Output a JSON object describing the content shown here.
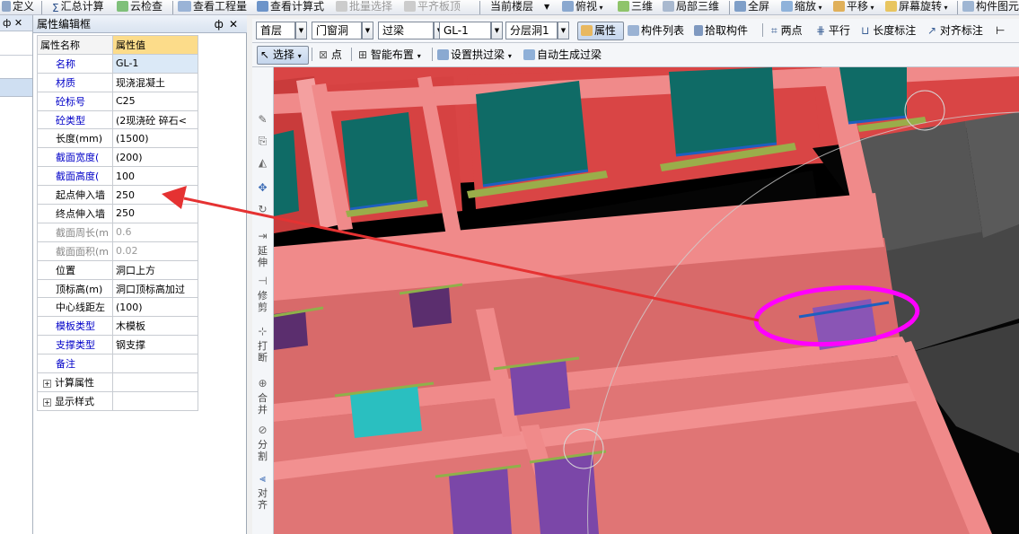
{
  "toolbar": {
    "items": [
      "定义",
      "汇总计算",
      "云检查",
      "查看工程量",
      "查看计算式",
      "批量选择",
      "平齐板顶",
      "当前楼层",
      "俯视",
      "三维",
      "局部三维",
      "全屏",
      "缩放",
      "平移",
      "屏幕旋转",
      "构件图元"
    ]
  },
  "panel": {
    "title": "属性编辑框",
    "pin_icon": "pin-icon",
    "close_icon": "close-icon",
    "header": {
      "name": "属性名称",
      "value": "属性值"
    },
    "rows": [
      {
        "name": "名称",
        "value": "GL-1",
        "name_color": "blue",
        "value_style": "sel"
      },
      {
        "name": "材质",
        "value": "现浇混凝土",
        "name_color": "blue"
      },
      {
        "name": "砼标号",
        "value": "C25",
        "name_color": "blue"
      },
      {
        "name": "砼类型",
        "value": "(2现浇砼 碎石<",
        "name_color": "blue"
      },
      {
        "name": "长度(mm)",
        "value": "(1500)",
        "name_color": "black"
      },
      {
        "name": "截面宽度(",
        "value": "(200)",
        "name_color": "blue"
      },
      {
        "name": "截面高度(",
        "value": "100",
        "name_color": "blue"
      },
      {
        "name": "起点伸入墙",
        "value": "250",
        "name_color": "black"
      },
      {
        "name": "终点伸入墙",
        "value": "250",
        "name_color": "black"
      },
      {
        "name": "截面周长(m",
        "value": "0.6",
        "name_color": "grey",
        "value_style": "grey"
      },
      {
        "name": "截面面积(m",
        "value": "0.02",
        "name_color": "grey",
        "value_style": "grey"
      },
      {
        "name": "位置",
        "value": "洞口上方",
        "name_color": "black"
      },
      {
        "name": "顶标高(m)",
        "value": "洞口顶标高加过",
        "name_color": "black"
      },
      {
        "name": "中心线距左",
        "value": "(100)",
        "name_color": "black"
      },
      {
        "name": "模板类型",
        "value": "木模板",
        "name_color": "blue"
      },
      {
        "name": "支撑类型",
        "value": "钢支撑",
        "name_color": "blue"
      },
      {
        "name": "备注",
        "value": "",
        "name_color": "blue"
      },
      {
        "name": "计算属性",
        "value": "",
        "name_color": "black",
        "expand": true
      },
      {
        "name": "显示样式",
        "value": "",
        "name_color": "black",
        "expand": true
      }
    ]
  },
  "row1": {
    "floor": "首层",
    "category": "门窗洞",
    "type": "过梁",
    "component": "GL-1",
    "layer": "分层洞1",
    "property_btn": "属性",
    "list_btn": "构件列表",
    "pick_btn": "拾取构件",
    "two_point": "两点",
    "parallel": "平行",
    "length_mark": "长度标注",
    "align_mark": "对齐标注"
  },
  "row2": {
    "select": "选择",
    "point": "点",
    "smart": "智能布置",
    "set_arch": "设置拱过梁",
    "auto_gen": "自动生成过梁"
  },
  "vtools": [
    "延伸",
    "修剪",
    "打断",
    "合并",
    "分割",
    "对齐"
  ],
  "colors": {
    "wall": "#f08a8a",
    "wall_dark": "#d94545",
    "window": "#0f6b66",
    "sill": "#9aad4a",
    "lintel": "#1e5fbf",
    "opening": "#7b47a8",
    "highlight": "#ff00ff",
    "arrow": "#e53232"
  }
}
